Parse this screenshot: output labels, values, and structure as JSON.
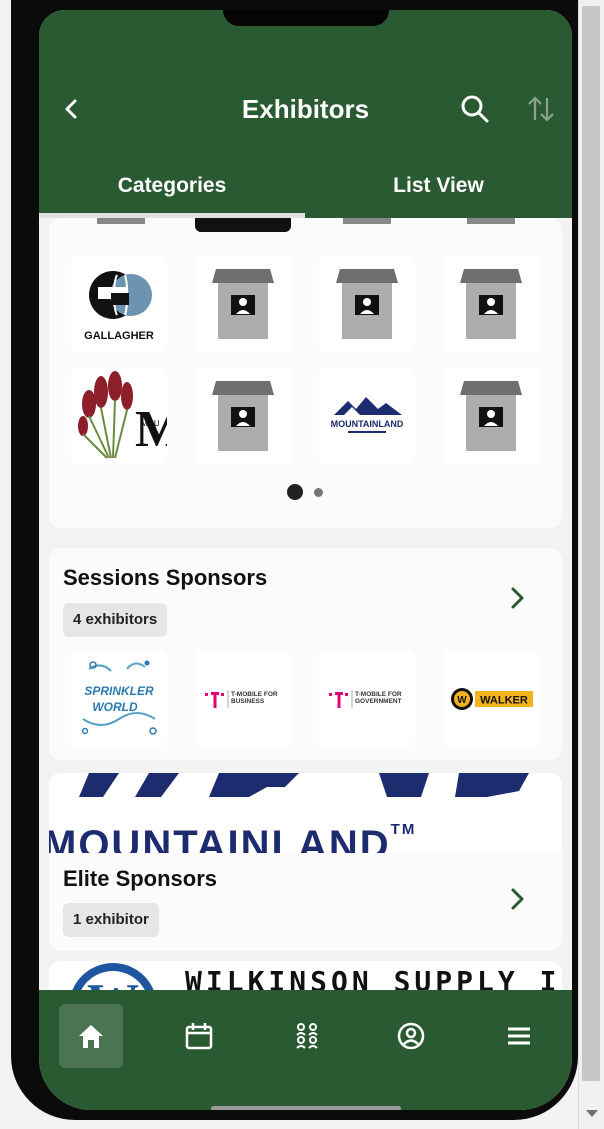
{
  "header": {
    "title": "Exhibitors",
    "tabs": [
      {
        "label": "Categories",
        "active": true
      },
      {
        "label": "List View",
        "active": false
      }
    ]
  },
  "previous_category": {
    "logos": [
      {
        "name": "Gallagher",
        "text": "GALLAGHER"
      },
      {
        "name": "placeholder-booth",
        "text": ""
      },
      {
        "name": "placeholder-booth",
        "text": ""
      },
      {
        "name": "placeholder-booth",
        "text": ""
      },
      {
        "name": "Mountain plant logo",
        "text": "MOU"
      },
      {
        "name": "placeholder-booth",
        "text": ""
      },
      {
        "name": "Mountainland",
        "text": "MOUNTAINLAND"
      },
      {
        "name": "placeholder-booth",
        "text": ""
      }
    ],
    "pagination": {
      "current_page": 1,
      "pages": 2
    }
  },
  "sessions_sponsors": {
    "title": "Sessions Sponsors",
    "count_label": "4 exhibitors",
    "logos": [
      {
        "name": "Sprinkler World",
        "line1": "SPRINKLER",
        "line2": "WORLD"
      },
      {
        "name": "T-Mobile for Business",
        "text": "T-MOBILE FOR BUSINESS"
      },
      {
        "name": "T-Mobile for Government",
        "text": "T-MOBILE FOR GOVERNMENT"
      },
      {
        "name": "Walker",
        "text": "WALKER"
      }
    ]
  },
  "elite_sponsors": {
    "title": "Elite Sponsors",
    "count_label": "1 exhibitor",
    "banner_text": "MOUNTAINLAND",
    "banner_tm": "TM"
  },
  "next_banner": {
    "text": "WILKINSON SUPPLY INC"
  },
  "bottom_nav": {
    "items": [
      {
        "icon": "home-icon",
        "active": true
      },
      {
        "icon": "calendar-icon",
        "active": false
      },
      {
        "icon": "people-icon",
        "active": false
      },
      {
        "icon": "profile-icon",
        "active": false
      },
      {
        "icon": "menu-icon",
        "active": false
      }
    ]
  },
  "colors": {
    "brand_green": "#2a5a31",
    "active_nav": "#4b7451",
    "navy": "#1d2b6f"
  }
}
